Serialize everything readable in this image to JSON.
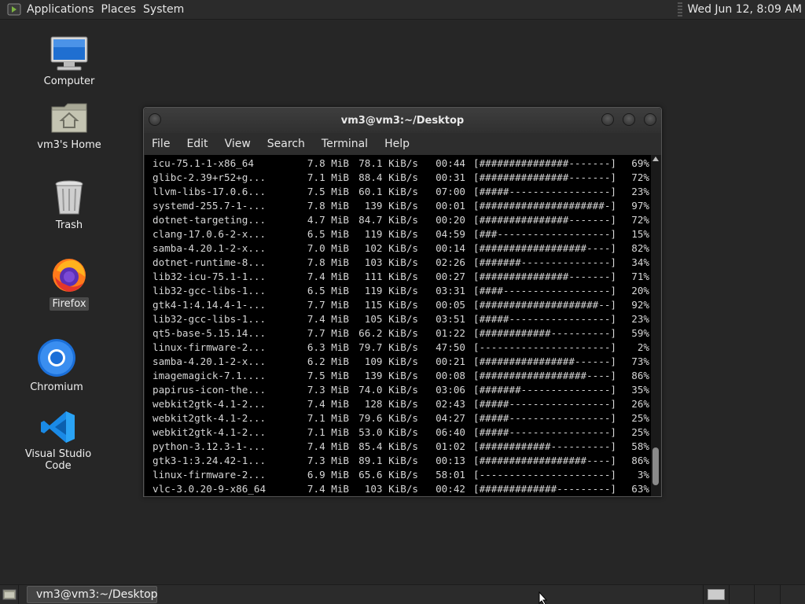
{
  "top_panel": {
    "menus": [
      "Applications",
      "Places",
      "System"
    ],
    "clock": "Wed Jun 12,  8:09 AM"
  },
  "desktop_icons": [
    {
      "label": "Computer",
      "icon": "computer-icon"
    },
    {
      "label": "vm3's Home",
      "icon": "home-folder-icon"
    },
    {
      "label": "Trash",
      "icon": "trash-icon"
    },
    {
      "label": "Firefox",
      "icon": "firefox-icon"
    },
    {
      "label": "Chromium",
      "icon": "chromium-icon"
    },
    {
      "label": "Visual Studio Code",
      "icon": "vscode-icon"
    }
  ],
  "terminal": {
    "title": "vm3@vm3:~/Desktop",
    "menu": [
      "File",
      "Edit",
      "View",
      "Search",
      "Terminal",
      "Help"
    ],
    "rows": [
      {
        "name": "icu-75.1-1-x86_64",
        "size": "7.8 MiB",
        "rate": "78.1 KiB/s",
        "eta": "00:44",
        "bar": "[###############-------]",
        "pct": "69%"
      },
      {
        "name": "glibc-2.39+r52+g...",
        "size": "7.1 MiB",
        "rate": "88.4 KiB/s",
        "eta": "00:31",
        "bar": "[###############-------]",
        "pct": "72%"
      },
      {
        "name": "llvm-libs-17.0.6...",
        "size": "7.5 MiB",
        "rate": "60.1 KiB/s",
        "eta": "07:00",
        "bar": "[#####-----------------]",
        "pct": "23%"
      },
      {
        "name": "systemd-255.7-1-...",
        "size": "7.8 MiB",
        "rate": "139 KiB/s",
        "eta": "00:01",
        "bar": "[#####################-]",
        "pct": "97%"
      },
      {
        "name": "dotnet-targeting...",
        "size": "4.7 MiB",
        "rate": "84.7 KiB/s",
        "eta": "00:20",
        "bar": "[###############-------]",
        "pct": "72%"
      },
      {
        "name": "clang-17.0.6-2-x...",
        "size": "6.5 MiB",
        "rate": "119 KiB/s",
        "eta": "04:59",
        "bar": "[###-------------------]",
        "pct": "15%"
      },
      {
        "name": "samba-4.20.1-2-x...",
        "size": "7.0 MiB",
        "rate": "102 KiB/s",
        "eta": "00:14",
        "bar": "[##################----]",
        "pct": "82%"
      },
      {
        "name": "dotnet-runtime-8...",
        "size": "7.8 MiB",
        "rate": "103 KiB/s",
        "eta": "02:26",
        "bar": "[#######---------------]",
        "pct": "34%"
      },
      {
        "name": "lib32-icu-75.1-1...",
        "size": "7.4 MiB",
        "rate": "111 KiB/s",
        "eta": "00:27",
        "bar": "[###############-------]",
        "pct": "71%"
      },
      {
        "name": "lib32-gcc-libs-1...",
        "size": "6.5 MiB",
        "rate": "119 KiB/s",
        "eta": "03:31",
        "bar": "[####------------------]",
        "pct": "20%"
      },
      {
        "name": "gtk4-1:4.14.4-1-...",
        "size": "7.7 MiB",
        "rate": "115 KiB/s",
        "eta": "00:05",
        "bar": "[####################--]",
        "pct": "92%"
      },
      {
        "name": "lib32-gcc-libs-1...",
        "size": "7.4 MiB",
        "rate": "105 KiB/s",
        "eta": "03:51",
        "bar": "[#####-----------------]",
        "pct": "23%"
      },
      {
        "name": "qt5-base-5.15.14...",
        "size": "7.7 MiB",
        "rate": "66.2 KiB/s",
        "eta": "01:22",
        "bar": "[############----------]",
        "pct": "59%"
      },
      {
        "name": "linux-firmware-2...",
        "size": "6.3 MiB",
        "rate": "79.7 KiB/s",
        "eta": "47:50",
        "bar": "[----------------------]",
        "pct": "2%"
      },
      {
        "name": "samba-4.20.1-2-x...",
        "size": "6.2 MiB",
        "rate": "109 KiB/s",
        "eta": "00:21",
        "bar": "[################------]",
        "pct": "73%"
      },
      {
        "name": "imagemagick-7.1....",
        "size": "7.5 MiB",
        "rate": "139 KiB/s",
        "eta": "00:08",
        "bar": "[##################----]",
        "pct": "86%"
      },
      {
        "name": "papirus-icon-the...",
        "size": "7.3 MiB",
        "rate": "74.0 KiB/s",
        "eta": "03:06",
        "bar": "[#######---------------]",
        "pct": "35%"
      },
      {
        "name": "webkit2gtk-4.1-2...",
        "size": "7.4 MiB",
        "rate": "128 KiB/s",
        "eta": "02:43",
        "bar": "[#####-----------------]",
        "pct": "26%"
      },
      {
        "name": "webkit2gtk-4.1-2...",
        "size": "7.1 MiB",
        "rate": "79.6 KiB/s",
        "eta": "04:27",
        "bar": "[#####-----------------]",
        "pct": "25%"
      },
      {
        "name": "webkit2gtk-4.1-2...",
        "size": "7.1 MiB",
        "rate": "53.0 KiB/s",
        "eta": "06:40",
        "bar": "[#####-----------------]",
        "pct": "25%"
      },
      {
        "name": "python-3.12.3-1-...",
        "size": "7.4 MiB",
        "rate": "85.4 KiB/s",
        "eta": "01:02",
        "bar": "[############----------]",
        "pct": "58%"
      },
      {
        "name": "gtk3-1:3.24.42-1...",
        "size": "7.3 MiB",
        "rate": "89.1 KiB/s",
        "eta": "00:13",
        "bar": "[##################----]",
        "pct": "86%"
      },
      {
        "name": "linux-firmware-2...",
        "size": "6.9 MiB",
        "rate": "65.6 KiB/s",
        "eta": "58:01",
        "bar": "[----------------------]",
        "pct": "3%"
      },
      {
        "name": "vlc-3.0.20-9-x86_64",
        "size": "7.4 MiB",
        "rate": "103 KiB/s",
        "eta": "00:42",
        "bar": "[#############---------]",
        "pct": "63%"
      }
    ]
  },
  "taskbar": {
    "window_label": "vm3@vm3:~/Desktop"
  },
  "colors": {
    "desktop_bg": "#262626",
    "panel_bg": "#2b2b2b",
    "terminal_bg": "#000000",
    "terminal_fg": "#d6d6d6"
  }
}
